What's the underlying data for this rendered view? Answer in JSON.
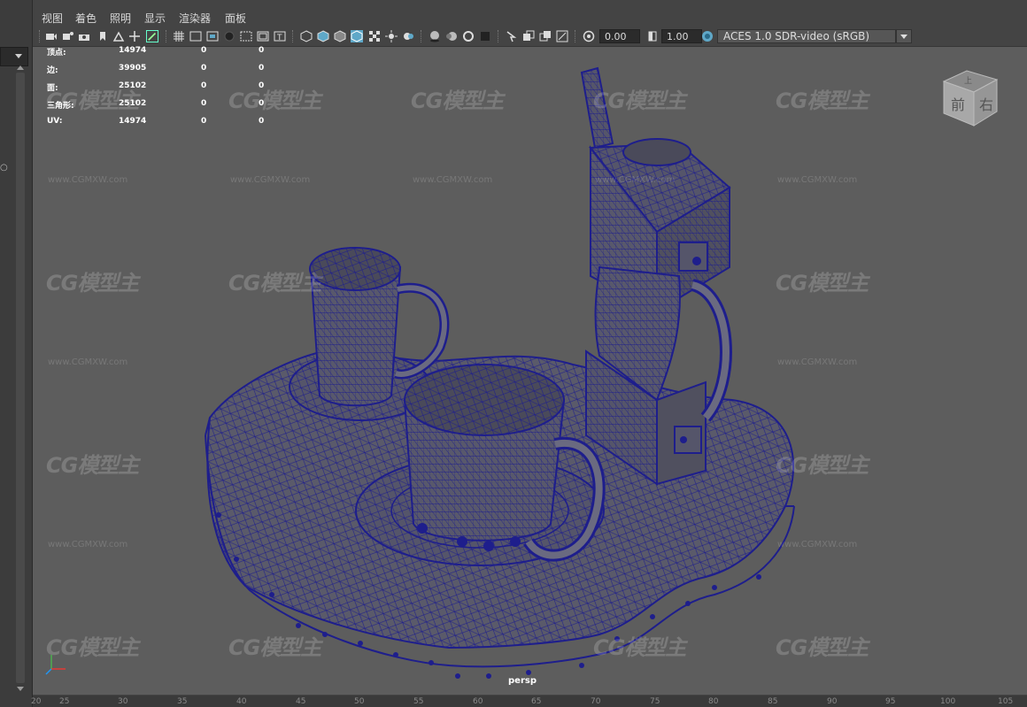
{
  "menu": [
    "视图",
    "着色",
    "照明",
    "显示",
    "渲染器",
    "面板"
  ],
  "toolbar": {
    "exposure_value": "0.00",
    "gamma_value": "1.00",
    "color_transform": "ACES 1.0 SDR-video (sRGB)",
    "icons": [
      "camera-icon",
      "camera-attr-icon",
      "bookmark-icon",
      "image-plane-icon",
      "grid-icon",
      "film-gate-icon",
      "wireframe-icon",
      "smooth-shade-icon",
      "texture-icon",
      "light-icon",
      "shadow-icon",
      "isolate-icon",
      "xray-icon",
      "exposure-icon",
      "gamma-icon",
      "color-mgmt-icon"
    ]
  },
  "stats": {
    "rows": [
      {
        "label": "顶点:",
        "total": "14974",
        "sel": "0",
        "comp": "0"
      },
      {
        "label": "边:",
        "total": "39905",
        "sel": "0",
        "comp": "0"
      },
      {
        "label": "面:",
        "total": "25102",
        "sel": "0",
        "comp": "0"
      },
      {
        "label": "三角形:",
        "total": "25102",
        "sel": "0",
        "comp": "0"
      },
      {
        "label": "UV:",
        "total": "14974",
        "sel": "0",
        "comp": "0"
      }
    ]
  },
  "viewcube": {
    "front": "前",
    "right": "右",
    "top": "上"
  },
  "camera_label": "persp",
  "watermark": {
    "logo": "CG模型主",
    "url": "www.CGMXW.com"
  },
  "ruler": [
    "20",
    "25",
    "30",
    "35",
    "40",
    "45",
    "50",
    "55",
    "60",
    "65",
    "70",
    "75",
    "80",
    "85",
    "90",
    "95",
    "100",
    "105"
  ],
  "colors": {
    "wire": "#1e1e8c",
    "bg": "#5d5d5d",
    "accent": "#5fa8c8"
  }
}
